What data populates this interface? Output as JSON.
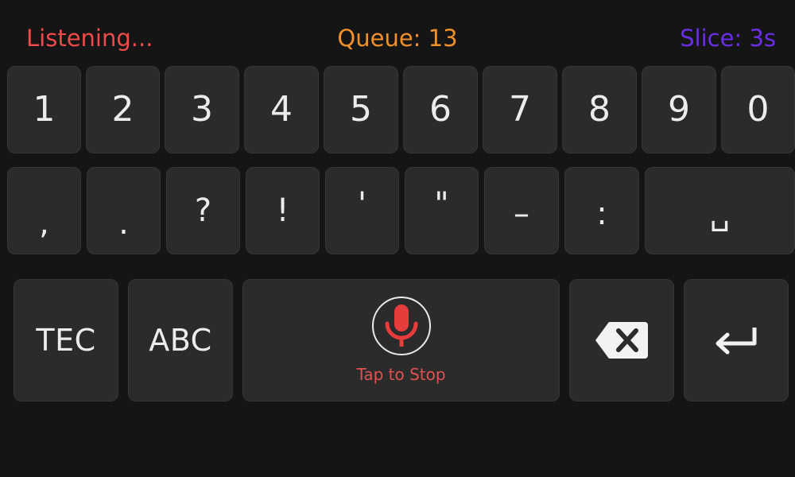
{
  "status": {
    "left": "Listening...",
    "center": "Queue: 13",
    "right": "Slice: 3s"
  },
  "row1": [
    "1",
    "2",
    "3",
    "4",
    "5",
    "6",
    "7",
    "8",
    "9",
    "0"
  ],
  "row2": [
    ",",
    ".",
    "?",
    "!",
    "'",
    "\"",
    "–",
    ":",
    "␣"
  ],
  "row3": {
    "tec_label": "TEC",
    "abc_label": "ABC",
    "mic_label": "Tap to Stop"
  },
  "colors": {
    "listening": "#f04a4a",
    "queue": "#f0902a",
    "slice": "#6a2ee6",
    "mic": "#e83b3b",
    "key_bg": "#2b2b2b",
    "bg": "#151515"
  },
  "icons": {
    "mic": "microphone-icon",
    "backspace": "backspace-icon",
    "enter": "enter-return-icon"
  }
}
